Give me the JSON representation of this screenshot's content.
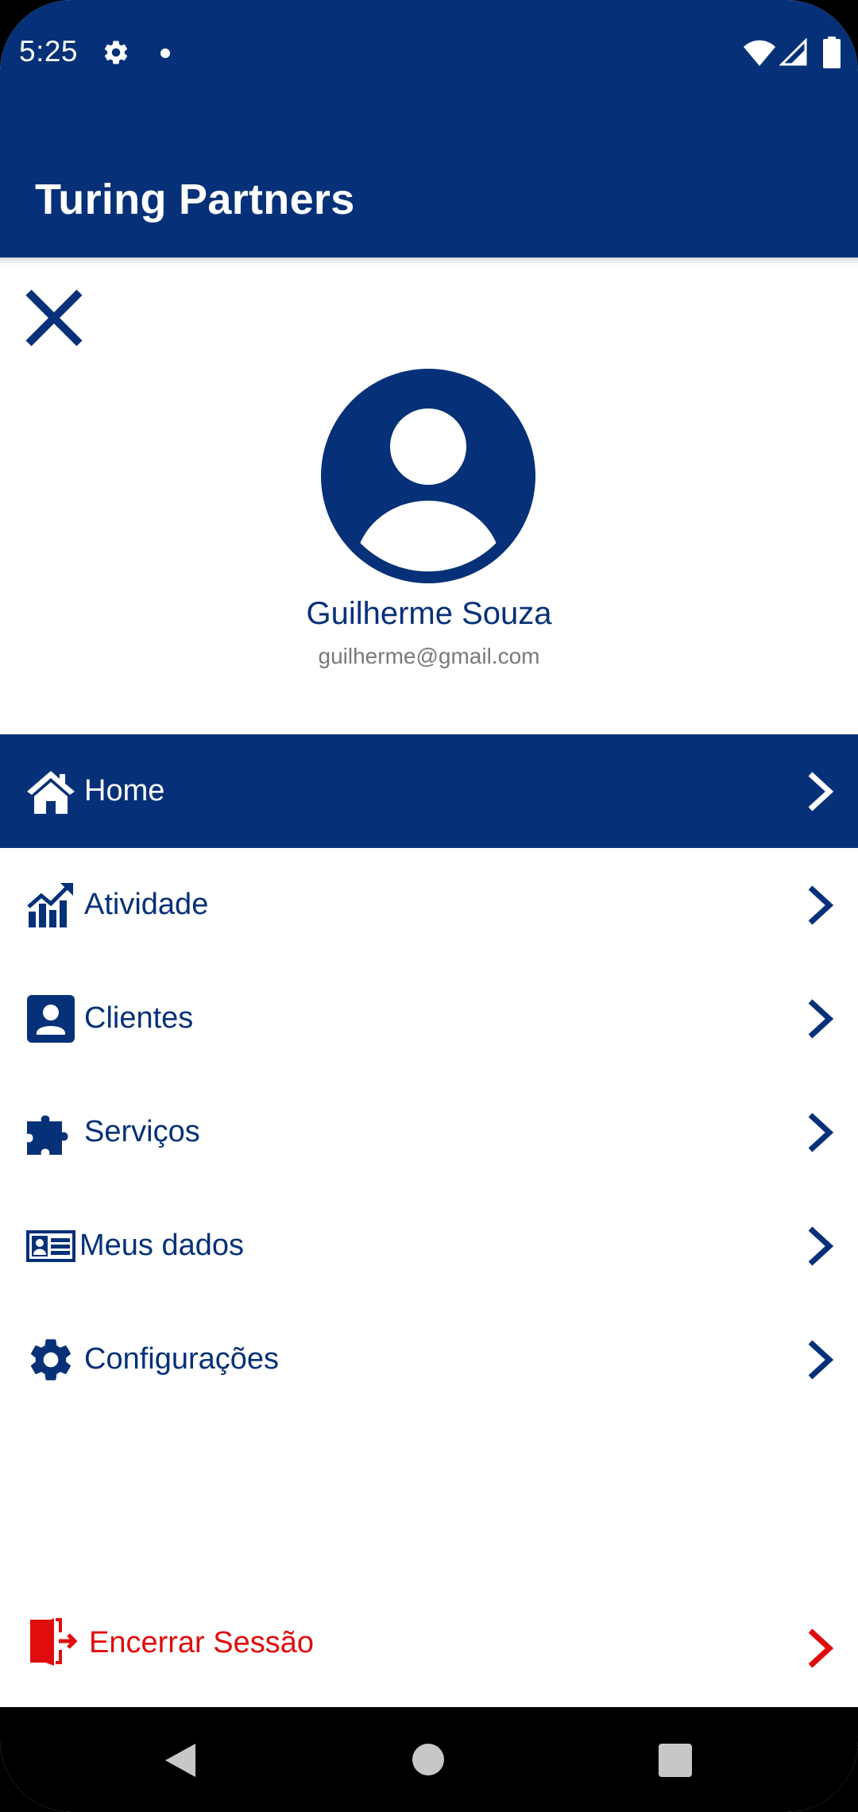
{
  "status_bar": {
    "time": "5:25",
    "icons": [
      "settings-icon",
      "notification-dot",
      "wifi-icon",
      "signal-icon",
      "battery-icon"
    ]
  },
  "app_bar": {
    "title": "Turing Partners"
  },
  "drawer": {
    "close_icon": "close-icon",
    "avatar_icon": "account-circle-icon",
    "user": {
      "name": "Guilherme Souza",
      "email": "guilherme@gmail.com"
    },
    "menu": [
      {
        "label": "Home",
        "icon": "home-icon",
        "active": true
      },
      {
        "label": "Atividade",
        "icon": "chart-line-icon",
        "active": false
      },
      {
        "label": "Clientes",
        "icon": "contact-icon",
        "active": false
      },
      {
        "label": "Serviços",
        "icon": "puzzle-icon",
        "active": false
      },
      {
        "label": "Meus dados",
        "icon": "id-card-icon",
        "active": false
      },
      {
        "label": "Configurações",
        "icon": "gear-icon",
        "active": false
      }
    ],
    "logout": {
      "label": "Encerrar Sessão",
      "icon": "logout-door-icon"
    }
  },
  "colors": {
    "primary": "#063178",
    "danger": "#e00d0d",
    "text_secondary": "#7a7a7a"
  },
  "nav_bar": {
    "buttons": [
      "back-icon",
      "home-circle-icon",
      "recents-square-icon"
    ]
  }
}
